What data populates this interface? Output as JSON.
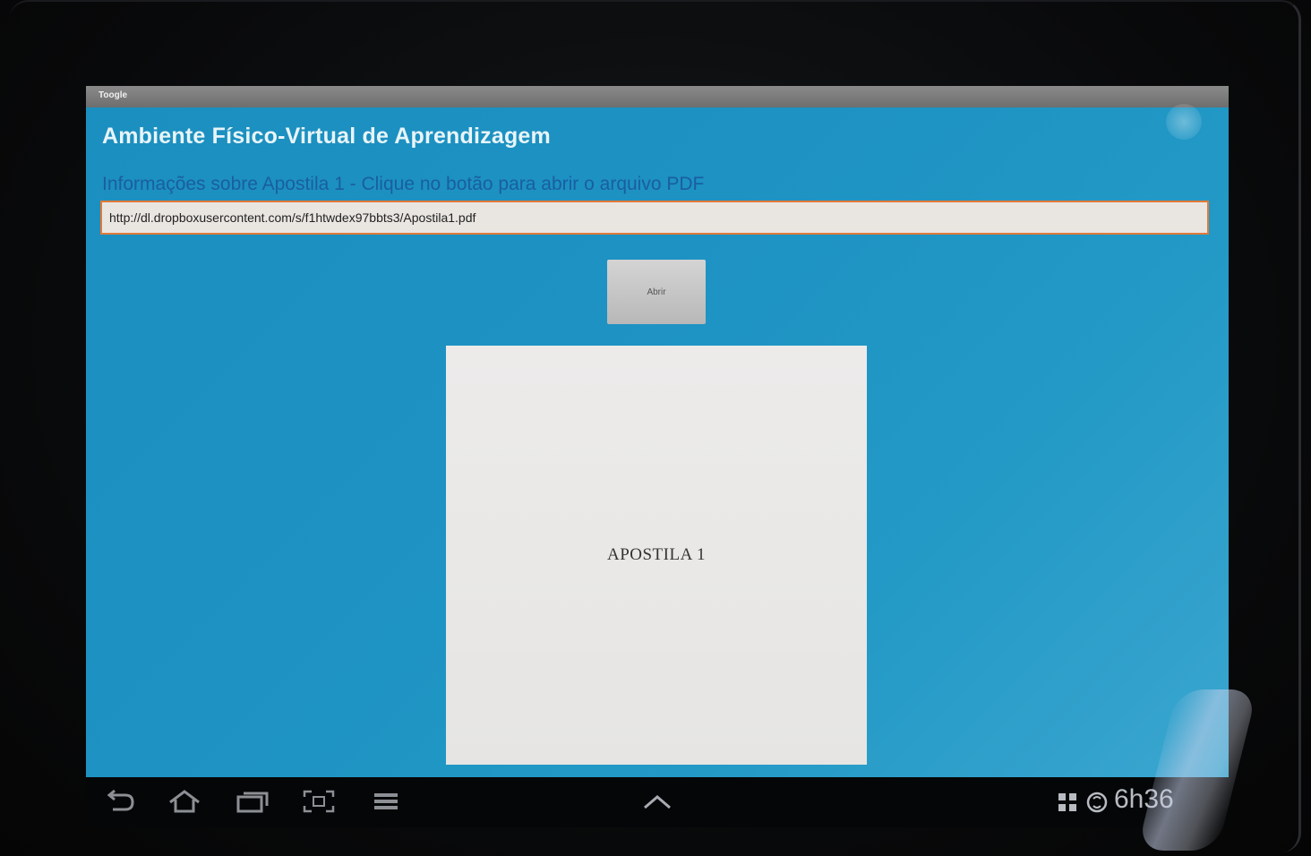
{
  "window": {
    "titlebar_text": "Toogle"
  },
  "app": {
    "title": "Ambiente Físico-Virtual de Aprendizagem",
    "info_label": "Informações sobre Apostila 1 - Clique no botão para abrir o arquivo PDF",
    "url_value": "http://dl.dropboxusercontent.com/s/f1htwdex97bbts3/Apostila1.pdf",
    "open_button_label": "Abrir",
    "preview_text": "APOSTILA 1"
  },
  "system_bar": {
    "clock": "6h36",
    "icons": [
      "back-icon",
      "home-icon",
      "recent-apps-icon",
      "screenshot-icon",
      "menu-icon",
      "chevron-up-icon",
      "grid-icon",
      "sync-icon"
    ]
  },
  "colors": {
    "screen_bg": "#1d92c3",
    "url_border": "#e07a3a",
    "info_label": "#1a5ea0"
  }
}
